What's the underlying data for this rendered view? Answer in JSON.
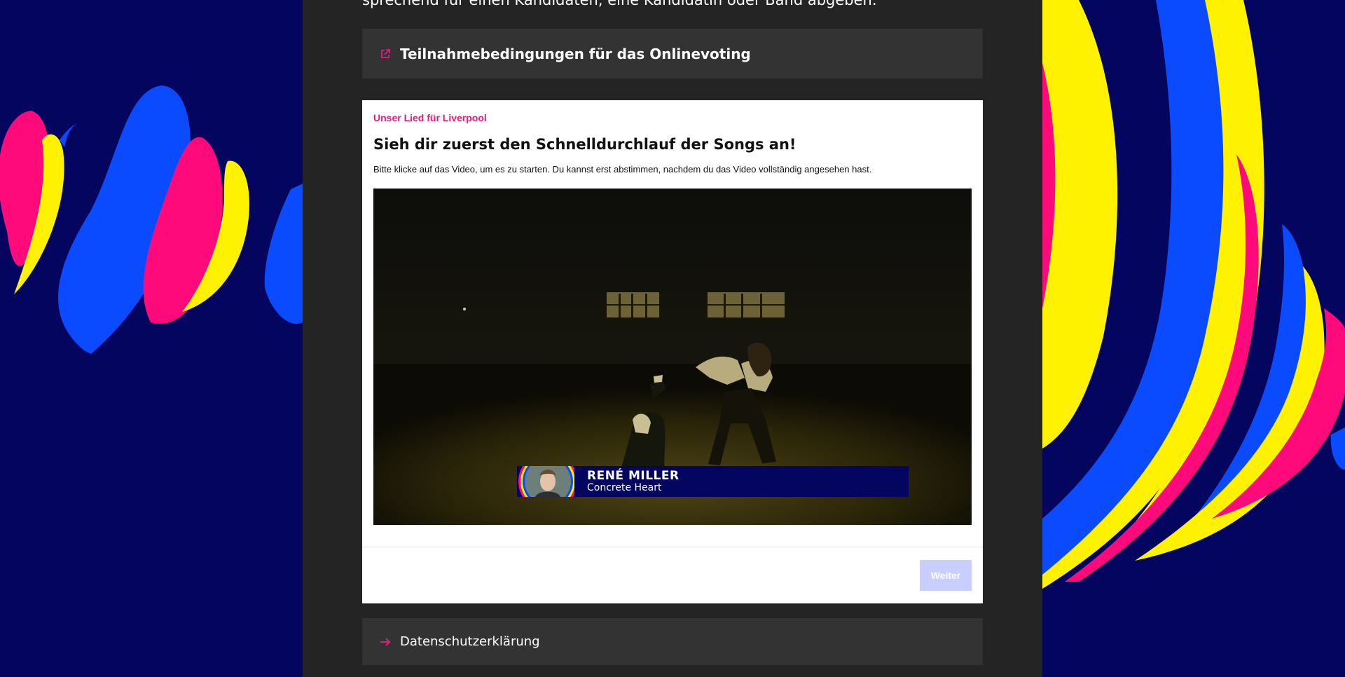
{
  "intro": {
    "text": "sprechend für einen Kandidaten, eine Kandidatin oder Band abgeben."
  },
  "terms_link": {
    "label": "Teilnahmebedingungen für das Onlinevoting",
    "icon": "external-link-icon"
  },
  "card": {
    "eyebrow": "Unser Lied für Liverpool",
    "title": "Sieh dir zuerst den Schnelldurchlauf der Songs an!",
    "description": "Bitte klicke auf das Video, um es zu starten. Du kannst erst abstimmen, nachdem du das Video vollständig angesehen hast.",
    "video": {
      "artist": "RENÉ MILLER",
      "song": "Concrete Heart"
    },
    "next_label": "Weiter"
  },
  "privacy_link": {
    "label": "Datenschutzerklärung",
    "icon": "arrow-right-icon"
  },
  "colors": {
    "background": "#04055f",
    "column": "#242424",
    "link_bar": "#333333",
    "accent_pink": "#e5197f",
    "brand_blue": "#0a4bff",
    "brand_yellow": "#fff200",
    "brand_magenta": "#ff0a7a",
    "button_disabled": "#c8cfff"
  }
}
